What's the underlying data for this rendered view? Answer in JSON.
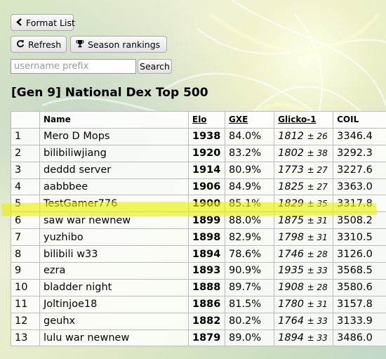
{
  "buttons": {
    "format_list": "Format List",
    "refresh": "Refresh",
    "season_rankings": "Season rankings",
    "search": "Search"
  },
  "icons": {
    "format_list": "chevron-left-icon",
    "refresh": "refresh-icon",
    "season_rankings": "trophy-icon"
  },
  "search": {
    "placeholder": "username prefix",
    "value": ""
  },
  "ladder": {
    "title": "[Gen 9] National Dex Top 500",
    "columns": [
      "",
      "Name",
      "Elo",
      "GXE",
      "Glicko-1",
      "COIL"
    ],
    "highlighted_rank": "5",
    "highlight_color": "#e8f000",
    "rows": [
      {
        "rank": "1",
        "name": "Mero D Mops",
        "elo": "1938",
        "gxe": "84.0%",
        "glicko": "1812",
        "dev": "± 26",
        "coil": "3346.4"
      },
      {
        "rank": "2",
        "name": "bilibiliwjiang",
        "elo": "1920",
        "gxe": "83.2%",
        "glicko": "1802",
        "dev": "± 38",
        "coil": "3292.3"
      },
      {
        "rank": "3",
        "name": "deddd server",
        "elo": "1914",
        "gxe": "80.9%",
        "glicko": "1773",
        "dev": "± 27",
        "coil": "3227.6"
      },
      {
        "rank": "4",
        "name": "aabbbee",
        "elo": "1906",
        "gxe": "84.9%",
        "glicko": "1825",
        "dev": "± 27",
        "coil": "3363.0"
      },
      {
        "rank": "5",
        "name": "TestGamer776",
        "elo": "1900",
        "gxe": "85.1%",
        "glicko": "1829",
        "dev": "± 35",
        "coil": "3317.8"
      },
      {
        "rank": "6",
        "name": "saw war newnew",
        "elo": "1899",
        "gxe": "88.0%",
        "glicko": "1875",
        "dev": "± 31",
        "coil": "3508.2"
      },
      {
        "rank": "7",
        "name": "yuzhibo",
        "elo": "1898",
        "gxe": "82.9%",
        "glicko": "1798",
        "dev": "± 31",
        "coil": "3310.5"
      },
      {
        "rank": "8",
        "name": "bilibili w33",
        "elo": "1894",
        "gxe": "78.6%",
        "glicko": "1746",
        "dev": "± 28",
        "coil": "3126.0"
      },
      {
        "rank": "9",
        "name": "ezra",
        "elo": "1893",
        "gxe": "90.9%",
        "glicko": "1935",
        "dev": "± 33",
        "coil": "3568.5"
      },
      {
        "rank": "10",
        "name": "bladder night",
        "elo": "1888",
        "gxe": "89.7%",
        "glicko": "1908",
        "dev": "± 28",
        "coil": "3580.6"
      },
      {
        "rank": "11",
        "name": "Joltinjoe18",
        "elo": "1886",
        "gxe": "81.5%",
        "glicko": "1780",
        "dev": "± 31",
        "coil": "3157.8"
      },
      {
        "rank": "12",
        "name": "geuhx",
        "elo": "1882",
        "gxe": "80.2%",
        "glicko": "1764",
        "dev": "± 33",
        "coil": "3133.9"
      },
      {
        "rank": "13",
        "name": "lulu war newnew",
        "elo": "1879",
        "gxe": "89.0%",
        "glicko": "1894",
        "dev": "± 33",
        "coil": "3486.0"
      }
    ]
  }
}
